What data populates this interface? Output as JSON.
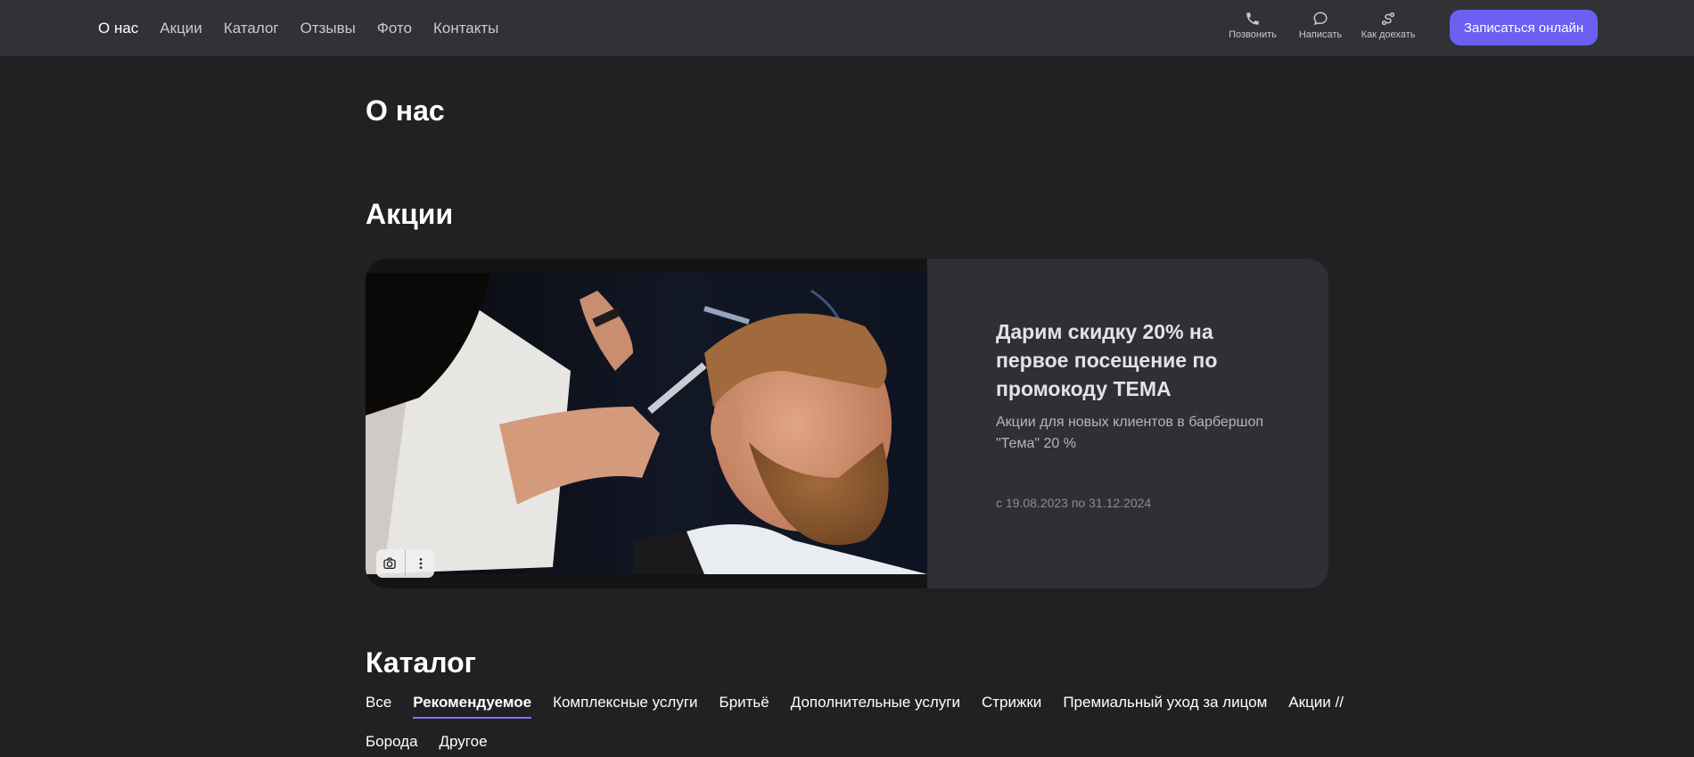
{
  "header": {
    "nav": [
      {
        "label": "О нас",
        "active": true
      },
      {
        "label": "Акции",
        "active": false
      },
      {
        "label": "Каталог",
        "active": false
      },
      {
        "label": "Отзывы",
        "active": false
      },
      {
        "label": "Фото",
        "active": false
      },
      {
        "label": "Контакты",
        "active": false
      }
    ],
    "actions": [
      {
        "label": "Позвонить",
        "icon": "phone-icon"
      },
      {
        "label": "Написать",
        "icon": "chat-icon"
      },
      {
        "label": "Как доехать",
        "icon": "route-icon"
      }
    ],
    "book_button": "Записаться онлайн",
    "accent": "#6b60f2"
  },
  "sections": {
    "about_title": "О нас",
    "promos_title": "Акции",
    "catalog_title": "Каталог"
  },
  "promo": {
    "title": "Дарим скидку 20% на первое посещение по промокоду ТЕМА",
    "subtitle": "Акции для новых клиентов в барбершоп \"Тема\" 20 %",
    "dates": "с 19.08.2023 по 31.12.2024",
    "image_icons": [
      "camera-lens-icon",
      "more-vertical-icon"
    ]
  },
  "catalog": {
    "tabs": [
      {
        "label": "Все",
        "active": false
      },
      {
        "label": "Рекомендуемое",
        "active": true
      },
      {
        "label": "Комплексные услуги",
        "active": false
      },
      {
        "label": "Бритьё",
        "active": false
      },
      {
        "label": "Дополнительные услуги",
        "active": false
      },
      {
        "label": "Стрижки",
        "active": false
      },
      {
        "label": "Премиальный уход за лицом",
        "active": false
      },
      {
        "label": "Акции //",
        "active": false
      },
      {
        "label": "Борода",
        "active": false
      },
      {
        "label": "Другое",
        "active": false
      }
    ]
  }
}
